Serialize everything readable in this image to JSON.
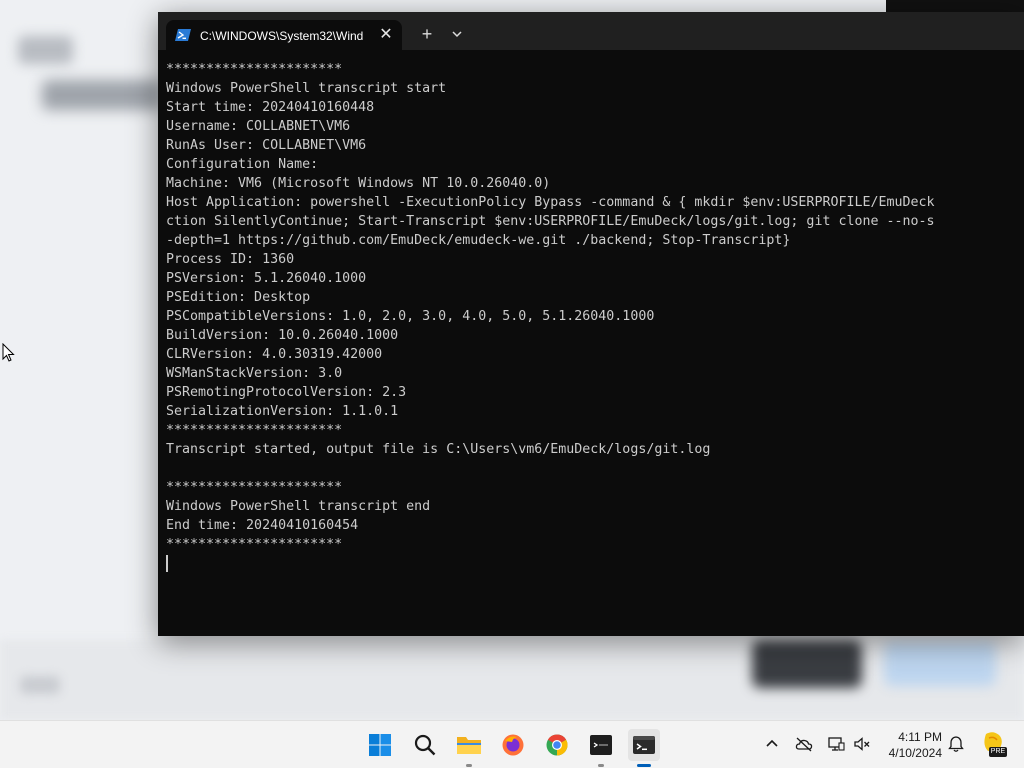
{
  "terminal": {
    "tab_title": "C:\\WINDOWS\\System32\\Wind",
    "new_tab_label": "+",
    "close_label": "✕",
    "lines": [
      "**********************",
      "Windows PowerShell transcript start",
      "Start time: 20240410160448",
      "Username: COLLABNET\\VM6",
      "RunAs User: COLLABNET\\VM6",
      "Configuration Name:",
      "Machine: VM6 (Microsoft Windows NT 10.0.26040.0)",
      "Host Application: powershell -ExecutionPolicy Bypass -command & { mkdir $env:USERPROFILE/EmuDeck",
      "ction SilentlyContinue; Start-Transcript $env:USERPROFILE/EmuDeck/logs/git.log; git clone --no-s",
      "-depth=1 https://github.com/EmuDeck/emudeck-we.git ./backend; Stop-Transcript}",
      "Process ID: 1360",
      "PSVersion: 5.1.26040.1000",
      "PSEdition: Desktop",
      "PSCompatibleVersions: 1.0, 2.0, 3.0, 4.0, 5.0, 5.1.26040.1000",
      "BuildVersion: 10.0.26040.1000",
      "CLRVersion: 4.0.30319.42000",
      "WSManStackVersion: 3.0",
      "PSRemotingProtocolVersion: 2.3",
      "SerializationVersion: 1.1.0.1",
      "**********************",
      "Transcript started, output file is C:\\Users\\vm6/EmuDeck/logs/git.log",
      "",
      "**********************",
      "Windows PowerShell transcript end",
      "End time: 20240410160454",
      "**********************"
    ]
  },
  "taskbar": {
    "apps": [
      {
        "name": "start-button",
        "icon": "windows-logo-icon"
      },
      {
        "name": "search-button",
        "icon": "search-icon"
      },
      {
        "name": "file-explorer",
        "icon": "folder-icon"
      },
      {
        "name": "firefox",
        "icon": "firefox-icon"
      },
      {
        "name": "chrome",
        "icon": "chrome-icon"
      },
      {
        "name": "emudeck-terminal",
        "icon": "terminal-app-icon"
      },
      {
        "name": "windows-terminal",
        "icon": "windows-terminal-icon"
      }
    ],
    "clock_time": "4:11 PM",
    "clock_date": "4/10/2024",
    "copilot_badge": "PRE"
  },
  "colors": {
    "terminal_bg": "#0c0c0c",
    "terminal_text": "#cccccc",
    "tab_bar": "#202020",
    "taskbar_bg": "#f3f3f3",
    "accent": "#005fb8"
  }
}
